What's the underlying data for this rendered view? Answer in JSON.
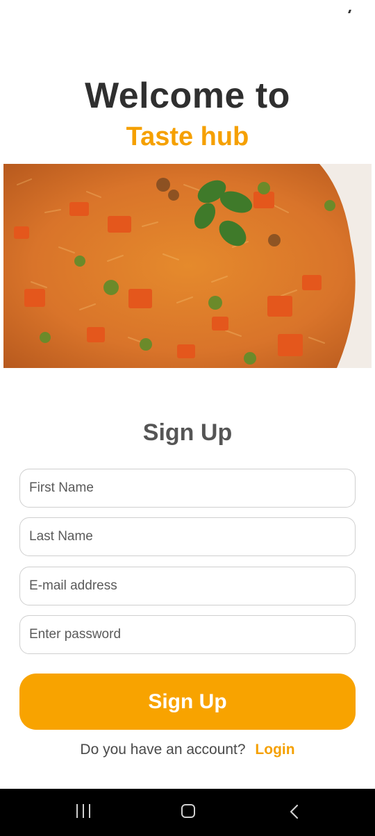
{
  "header": {
    "welcome": "Welcome to",
    "brand": "Taste hub"
  },
  "hero": {
    "icon": "food-image"
  },
  "form": {
    "heading": "Sign Up",
    "first_name_placeholder": "First Name",
    "last_name_placeholder": "Last Name",
    "email_placeholder": "E-mail address",
    "password_placeholder": "Enter password",
    "submit_label": "Sign Up"
  },
  "footer": {
    "question": "Do you have an account?",
    "login_label": "Login"
  },
  "colors": {
    "accent": "#f8a300",
    "brand": "#f5a000",
    "heading": "#2f2f2f"
  },
  "nav": {
    "recents_icon": "recents-icon",
    "home_icon": "home-icon",
    "back_icon": "back-icon"
  }
}
